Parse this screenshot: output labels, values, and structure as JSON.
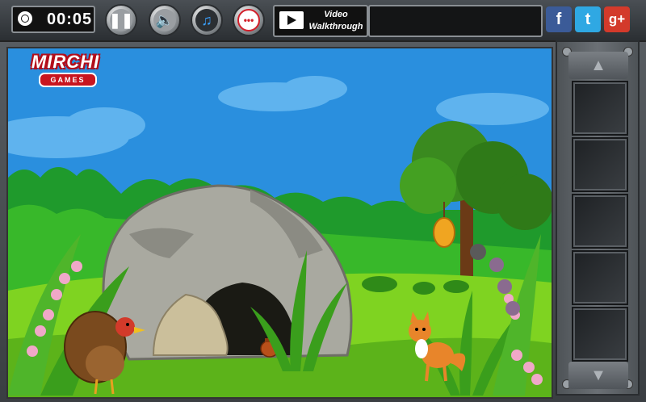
{
  "hud": {
    "timer": "00:05",
    "walkthrough_line1": "Video",
    "walkthrough_line2": "Walkthrough"
  },
  "logo": {
    "top": "MIRCHI",
    "bottom": "GAMES"
  },
  "social": {
    "facebook": "f",
    "twitter": "t",
    "googleplus": "g+"
  },
  "icons": {
    "pause": "pause-icon",
    "sound": "speaker-icon",
    "music": "music-note-icon",
    "chat": "chat-bubble-icon",
    "walkthrough": "film-play-icon",
    "inventory_up": "arrow-up-icon",
    "inventory_down": "arrow-down-icon"
  },
  "colors": {
    "sky": "#2a8fde",
    "grass": "#7fd321",
    "rock": "#a9a9a0",
    "brand_red": "#c8151f"
  },
  "inventory": {
    "slots": 5
  }
}
